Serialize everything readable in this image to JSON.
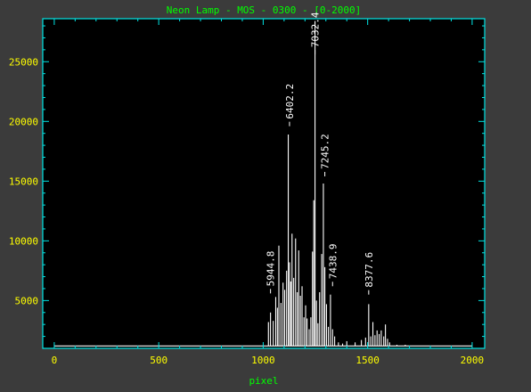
{
  "chart_data": {
    "type": "line",
    "title": "Neon Lamp - MOS - 0300 - [0-2000]",
    "xlabel": "pixel",
    "ylabel": "",
    "xlim": [
      -55,
      2060
    ],
    "ylim": [
      1000,
      28600
    ],
    "xticks": [
      0,
      500,
      1000,
      1500,
      2000
    ],
    "yticks": [
      5000,
      10000,
      15000,
      20000,
      25000
    ],
    "grid": false,
    "colors": {
      "background": "#000000",
      "frame": "#00e5e5",
      "title": "#00ff00",
      "tick_labels": "#ffff00",
      "axis_label": "#00ff00",
      "trace": "#ffffff",
      "annotations": "#ffffff"
    },
    "series": [
      {
        "baseline": 1200,
        "lines": [
          {
            "x": 1025,
            "y": 3200
          },
          {
            "x": 1035,
            "y": 4000
          },
          {
            "x": 1048,
            "y": 3300
          },
          {
            "x": 1060,
            "y": 5300
          },
          {
            "x": 1068,
            "y": 4400
          },
          {
            "x": 1075,
            "y": 9600
          },
          {
            "x": 1085,
            "y": 4800
          },
          {
            "x": 1095,
            "y": 6500
          },
          {
            "x": 1103,
            "y": 5900
          },
          {
            "x": 1112,
            "y": 7500
          },
          {
            "x": 1120,
            "y": 18900
          },
          {
            "x": 1126,
            "y": 8200
          },
          {
            "x": 1132,
            "y": 6600
          },
          {
            "x": 1138,
            "y": 10600
          },
          {
            "x": 1146,
            "y": 6900
          },
          {
            "x": 1155,
            "y": 10200
          },
          {
            "x": 1163,
            "y": 5700
          },
          {
            "x": 1170,
            "y": 9200
          },
          {
            "x": 1178,
            "y": 5400
          },
          {
            "x": 1186,
            "y": 6200
          },
          {
            "x": 1195,
            "y": 3600
          },
          {
            "x": 1203,
            "y": 4600
          },
          {
            "x": 1210,
            "y": 3500
          },
          {
            "x": 1220,
            "y": 2600
          },
          {
            "x": 1228,
            "y": 3600
          },
          {
            "x": 1236,
            "y": 9100
          },
          {
            "x": 1242,
            "y": 13400
          },
          {
            "x": 1248,
            "y": 28400
          },
          {
            "x": 1255,
            "y": 5000
          },
          {
            "x": 1262,
            "y": 3100
          },
          {
            "x": 1270,
            "y": 5700
          },
          {
            "x": 1280,
            "y": 8900
          },
          {
            "x": 1288,
            "y": 14800
          },
          {
            "x": 1295,
            "y": 7800
          },
          {
            "x": 1303,
            "y": 4700
          },
          {
            "x": 1312,
            "y": 2800
          },
          {
            "x": 1322,
            "y": 5500
          },
          {
            "x": 1332,
            "y": 2600
          },
          {
            "x": 1342,
            "y": 2000
          },
          {
            "x": 1360,
            "y": 1500
          },
          {
            "x": 1380,
            "y": 1400
          },
          {
            "x": 1400,
            "y": 1600
          },
          {
            "x": 1440,
            "y": 1500
          },
          {
            "x": 1470,
            "y": 1700
          },
          {
            "x": 1490,
            "y": 1900
          },
          {
            "x": 1505,
            "y": 4700
          },
          {
            "x": 1515,
            "y": 2000
          },
          {
            "x": 1525,
            "y": 3200
          },
          {
            "x": 1535,
            "y": 2100
          },
          {
            "x": 1545,
            "y": 2500
          },
          {
            "x": 1555,
            "y": 2200
          },
          {
            "x": 1565,
            "y": 2500
          },
          {
            "x": 1577,
            "y": 2000
          },
          {
            "x": 1585,
            "y": 3000
          },
          {
            "x": 1595,
            "y": 1800
          },
          {
            "x": 1605,
            "y": 1500
          },
          {
            "x": 1640,
            "y": 1300
          },
          {
            "x": 1680,
            "y": 1300
          }
        ]
      }
    ],
    "annotations": [
      {
        "label": "5944.8",
        "x": 1035,
        "y": 5600
      },
      {
        "label": "6402.2",
        "x": 1126,
        "y": 19600
      },
      {
        "label": "7032.4",
        "x": 1248,
        "y": 25600
      },
      {
        "label": "7245.2",
        "x": 1295,
        "y": 15400
      },
      {
        "label": "7438.9",
        "x": 1332,
        "y": 6200
      },
      {
        "label": "8377.6",
        "x": 1505,
        "y": 5500
      }
    ]
  }
}
